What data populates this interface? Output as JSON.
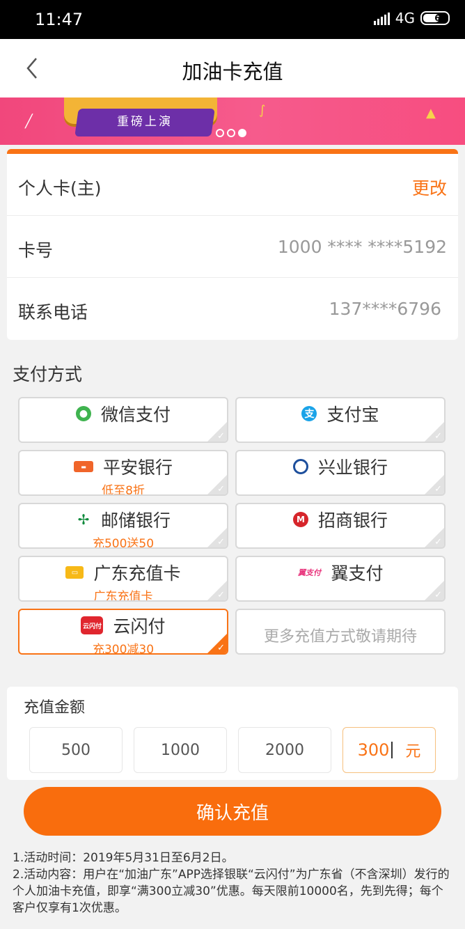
{
  "status_bar": {
    "time": "11:47",
    "network": "4G",
    "battery": "61"
  },
  "nav": {
    "title": "加油卡充值"
  },
  "banner": {
    "subtitle": "重磅上演"
  },
  "card_info": {
    "card_type": "个人卡(主)",
    "edit_label": "更改",
    "card_number_label": "卡号",
    "card_number": "1000 **** ****5192",
    "phone_label": "联系电话",
    "phone": "137****6796"
  },
  "payment": {
    "title": "支付方式",
    "methods": [
      {
        "label": "微信支付",
        "promo": ""
      },
      {
        "label": "支付宝",
        "promo": ""
      },
      {
        "label": "平安银行",
        "promo": "低至8折"
      },
      {
        "label": "兴业银行",
        "promo": ""
      },
      {
        "label": "邮储银行",
        "promo": "充500送50"
      },
      {
        "label": "招商银行",
        "promo": ""
      },
      {
        "label": "广东充值卡",
        "promo": "广东充值卡"
      },
      {
        "label": "翼支付",
        "promo": ""
      },
      {
        "label": "云闪付",
        "promo": "充300减30",
        "selected": true
      }
    ],
    "more_label": "更多充值方式敬请期待"
  },
  "amount": {
    "title": "充值金额",
    "options": [
      "500",
      "1000",
      "2000"
    ],
    "custom_value": "300",
    "unit": "元"
  },
  "confirm_label": "确认充值",
  "notes": [
    "1.活动时间：2019年5月31日至6月2日。",
    "2.活动内容：用户在“加油广东”APP选择银联“云闪付”为广东省（不含深圳）发行的个人加油卡充值，即享“满300立减30”优惠。每天限前10000名，先到先得；每个客户仅享有1次优惠。"
  ],
  "colors": {
    "accent": "#f97316",
    "button": "#f96d0d",
    "banner": "#f1477c"
  }
}
